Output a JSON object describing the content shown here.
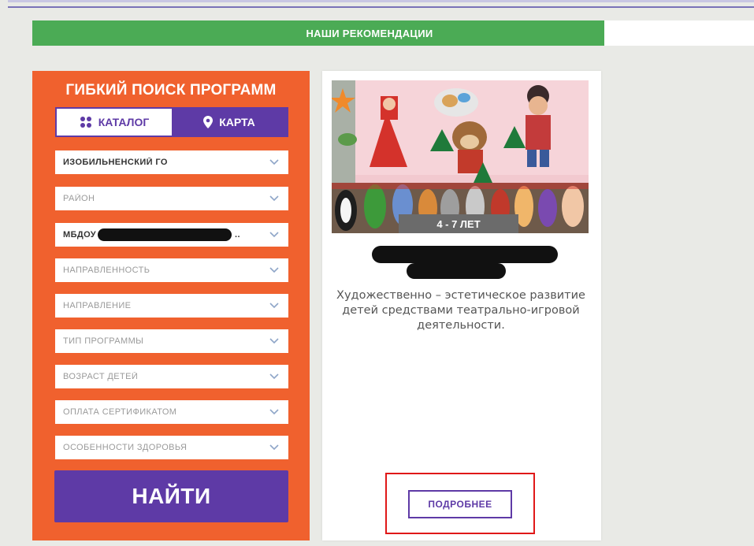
{
  "recommendations": {
    "title": "НАШИ РЕКОМЕНДАЦИИ"
  },
  "search": {
    "title": "ГИБКИЙ ПОИСК ПРОГРАММ",
    "tabs": {
      "catalog": "КАТАЛОГ",
      "map": "КАРТА"
    },
    "filters": {
      "municipality": "ИЗОБИЛЬНЕНСКИЙ ГО",
      "district": "РАЙОН",
      "organization_prefix": "МБДОУ",
      "organization_suffix": "..",
      "focus": "НАПРАВЛЕННОСТЬ",
      "direction": "НАПРАВЛЕНИЕ",
      "program_type": "ТИП ПРОГРАММЫ",
      "children_age": "ВОЗРАСТ ДЕТЕЙ",
      "certificate_payment": "ОПЛАТА СЕРТИФИКАТОМ",
      "health_features": "ОСОБЕННОСТИ ЗДОРОВЬЯ"
    },
    "find_label": "НАЙТИ"
  },
  "card": {
    "age": "4 - 7 ЛЕТ",
    "description": "Художественно – эстетическое развитие детей средствами театрально-игровой деятельности.",
    "more_label": "ПОДРОБНЕЕ"
  },
  "colors": {
    "panel": "#f0612e",
    "accent": "#5e3aa6",
    "green_bar": "#4bab55",
    "highlight": "#e01818"
  },
  "icons": {
    "catalog": "grid-dots-icon",
    "map": "map-pin-icon",
    "dropdown": "chevron-down-icon"
  }
}
